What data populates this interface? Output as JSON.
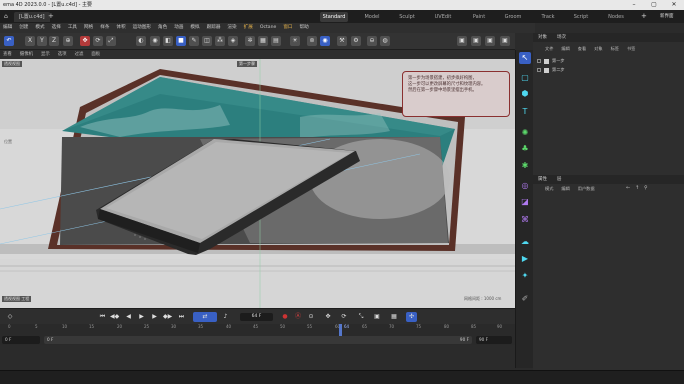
{
  "window": {
    "title": "ema 4D 2023.0.0 - [L置u.c4d] - 主要"
  },
  "tabs": {
    "doc": "[L置u.c4d]",
    "plus": "+",
    "layouts": [
      "Standard",
      "Model",
      "Sculpt",
      "UVEdit",
      "Paint",
      "Groom",
      "Track",
      "Script",
      "Nodes"
    ],
    "active_layout": "Standard",
    "new_layout": "新界面"
  },
  "menu": [
    "编辑",
    "创建",
    "模式",
    "选择",
    "工具",
    "网格",
    "样条",
    "体积",
    "运动图形",
    "角色",
    "动画",
    "模拟",
    "跟踪器",
    "渲染",
    "扩展",
    "Octane",
    "窗口",
    "帮助"
  ],
  "toolbar": {
    "axis_x": "X",
    "axis_y": "Y",
    "axis_z": "Z"
  },
  "viewport": {
    "menu": [
      "查看",
      "摄像机",
      "显示",
      "选项",
      "过滤",
      "面板"
    ],
    "label_tl": "透视视图",
    "label_top": "第一步骤",
    "label_left": "位置",
    "status_left": "透视视图 工程",
    "status_right": "网格间距 : 1000 cm"
  },
  "tooltip": {
    "lines": [
      "第一步为场景搭建，初步拟好构图，",
      "这一步可以更改屏幕的尺寸和纹理内容。",
      "然后在第一步骤中场景里摆出手机。"
    ]
  },
  "objects": {
    "tabs": [
      "对象",
      "场次"
    ],
    "menu": [
      "文件",
      "编辑",
      "查看",
      "对象",
      "标签",
      "书签"
    ],
    "rows": [
      "第一步",
      "第二步"
    ]
  },
  "attributes": {
    "tabs": [
      "属性",
      "层"
    ],
    "menu": [
      "模式",
      "编辑",
      "用户数据"
    ]
  },
  "transport": {
    "frame": "64 F"
  },
  "timeline": {
    "ticks": [
      "0",
      "5",
      "10",
      "15",
      "20",
      "25",
      "30",
      "35",
      "40",
      "45",
      "50",
      "55",
      "60",
      "65",
      "70",
      "75",
      "80",
      "85",
      "90"
    ],
    "current": "64",
    "start": "0 F",
    "start2": "0 F",
    "end": "90 F",
    "end2": "90 F"
  }
}
